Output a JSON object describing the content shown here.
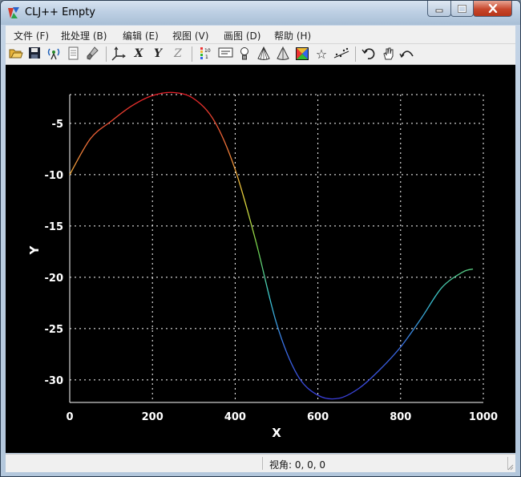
{
  "window": {
    "title": "CLJ++ Empty"
  },
  "menu": [
    "文件 (F)",
    "批处理 (B)",
    "编辑 (E)",
    "视图 (V)",
    "画图 (D)",
    "帮助 (H)"
  ],
  "toolbar_icons": [
    "open-folder-icon",
    "save-icon",
    "antenna-icon",
    "document-icon",
    "brush-icon",
    "axes-icon",
    "x-axis-icon",
    "y-axis-icon",
    "z-axis-icon",
    "color-scale-icon",
    "label-icon",
    "light-bulb-icon",
    "wireframe-cone-icon",
    "solid-cone-icon",
    "color-picture-icon",
    "star-icon",
    "scatter-icon",
    "rotate-icon",
    "hand-icon",
    "reset-view-icon"
  ],
  "toolbar_glyphs": {
    "x_axis": "X",
    "y_axis": "Y",
    "z_axis": "Z"
  },
  "status": {
    "view_angle": "视角: 0, 0, 0"
  },
  "chart_data": {
    "type": "line",
    "title": "",
    "xlabel": "X",
    "ylabel": "Y",
    "xlim": [
      0,
      1000
    ],
    "ylim": [
      -32,
      -2
    ],
    "x_ticks": [
      "0",
      "200",
      "400",
      "600",
      "800",
      "1000"
    ],
    "y_ticks": [
      "-5",
      "-10",
      "-15",
      "-20",
      "-25",
      "-30"
    ],
    "grid": true,
    "colormap": "rainbow by y (red high, blue low)",
    "x": [
      0,
      50,
      100,
      150,
      200,
      250,
      300,
      350,
      400,
      450,
      500,
      550,
      600,
      650,
      700,
      750,
      800,
      850,
      900,
      950,
      975
    ],
    "y": [
      -10,
      -6.5,
      -4.8,
      -3.3,
      -2.3,
      -2,
      -2.6,
      -4.8,
      -9.5,
      -16.5,
      -24.5,
      -29.5,
      -31.5,
      -31.8,
      -30.8,
      -29,
      -26.8,
      -24,
      -21,
      -19.5,
      -19.2
    ]
  }
}
